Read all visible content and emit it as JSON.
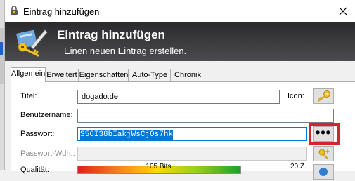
{
  "window": {
    "title": "Eintrag hinzufügen"
  },
  "banner": {
    "title": "Eintrag hinzufügen",
    "subtitle": "Einen neuen Eintrag erstellen."
  },
  "tabs": [
    {
      "label": "Allgemein",
      "active": true
    },
    {
      "label": "Erweitert"
    },
    {
      "label": "Eigenschaften"
    },
    {
      "label": "Auto-Type"
    },
    {
      "label": "Chronik"
    }
  ],
  "form": {
    "title_label": "Titel:",
    "title_value": "dogado.de",
    "icon_label": "Icon:",
    "username_label": "Benutzername:",
    "username_value": "",
    "password_label": "Passwort:",
    "password_value": "S56I38bIakjWsCjOs7hk",
    "reveal_button_label": "•••",
    "repeat_label": "Passwort-Wdh.:",
    "repeat_value": "",
    "quality_label": "Qualität:",
    "quality_bits": "105 Bits",
    "quality_count": "20 Z."
  },
  "colors": {
    "highlight": "#d8232a",
    "selection": "#0078d7"
  }
}
